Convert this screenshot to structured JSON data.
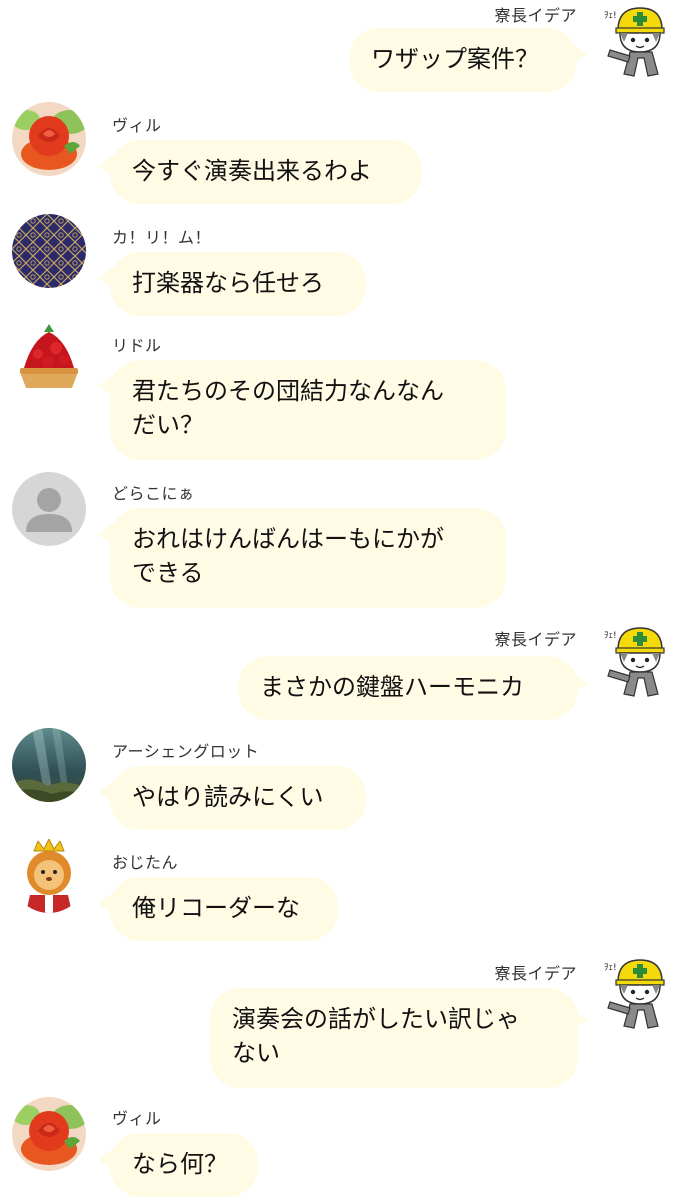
{
  "messages": [
    {
      "side": "right",
      "name": "寮長イデア",
      "text": "ワザップ案件？",
      "avatar": "cat-helmet-icon"
    },
    {
      "side": "left",
      "name": "ヴィル",
      "text": "今すぐ演奏出来るわよ",
      "avatar": "tomato-rose-icon"
    },
    {
      "side": "left",
      "name": "カ！リ！ム！",
      "text": "打楽器なら任せろ",
      "avatar": "pattern-icon"
    },
    {
      "side": "left",
      "name": "リドル",
      "text": "君たちのその団結力なんなん\nだい？",
      "avatar": "strawberry-tart-icon"
    },
    {
      "side": "left",
      "name": "どらこにぁ",
      "text": "おれはけんばんはーもにかが\nできる",
      "avatar": "default-user-icon"
    },
    {
      "side": "right",
      "name": "寮長イデア",
      "text": "まさかの鍵盤ハーモニカ",
      "avatar": "cat-helmet-icon"
    },
    {
      "side": "left",
      "name": "アーシェングロット",
      "text": "やはり読みにくい",
      "avatar": "underwater-icon"
    },
    {
      "side": "left",
      "name": "おじたん",
      "text": "俺リコーダーな",
      "avatar": "lion-king-icon"
    },
    {
      "side": "right",
      "name": "寮長イデア",
      "text": "演奏会の話がしたい訳じゃ\nない",
      "avatar": "cat-helmet-icon"
    },
    {
      "side": "left",
      "name": "ヴィル",
      "text": "なら何？",
      "avatar": "tomato-rose-icon"
    }
  ],
  "colors": {
    "bubble": "#fffbe5",
    "background": "#ffffff",
    "name_text": "#333333"
  }
}
